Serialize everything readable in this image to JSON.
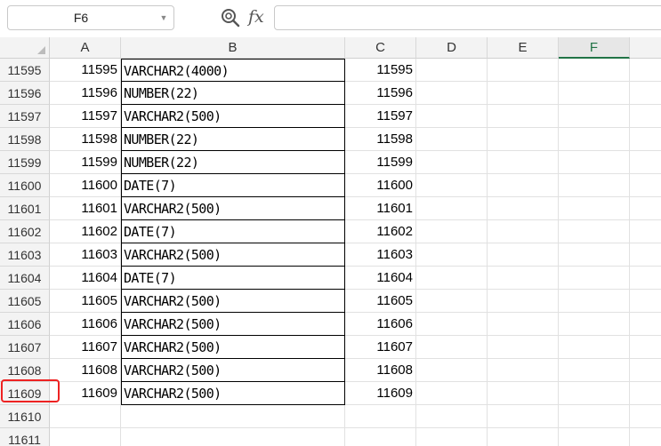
{
  "formula_bar": {
    "name_box": "F6",
    "fx_label": "fx",
    "formula_value": ""
  },
  "columns": [
    {
      "label": "A"
    },
    {
      "label": "B"
    },
    {
      "label": "C"
    },
    {
      "label": "D"
    },
    {
      "label": "E"
    },
    {
      "label": "F"
    }
  ],
  "active_column": "F",
  "rows": [
    {
      "row": "11595",
      "a": "11595",
      "b": "VARCHAR2(4000)",
      "c": "11595"
    },
    {
      "row": "11596",
      "a": "11596",
      "b": "NUMBER(22)",
      "c": "11596"
    },
    {
      "row": "11597",
      "a": "11597",
      "b": "VARCHAR2(500)",
      "c": "11597"
    },
    {
      "row": "11598",
      "a": "11598",
      "b": "NUMBER(22)",
      "c": "11598"
    },
    {
      "row": "11599",
      "a": "11599",
      "b": "NUMBER(22)",
      "c": "11599"
    },
    {
      "row": "11600",
      "a": "11600",
      "b": "DATE(7)",
      "c": "11600"
    },
    {
      "row": "11601",
      "a": "11601",
      "b": "VARCHAR2(500)",
      "c": "11601"
    },
    {
      "row": "11602",
      "a": "11602",
      "b": "DATE(7)",
      "c": "11602"
    },
    {
      "row": "11603",
      "a": "11603",
      "b": "VARCHAR2(500)",
      "c": "11603"
    },
    {
      "row": "11604",
      "a": "11604",
      "b": "DATE(7)",
      "c": "11604"
    },
    {
      "row": "11605",
      "a": "11605",
      "b": "VARCHAR2(500)",
      "c": "11605"
    },
    {
      "row": "11606",
      "a": "11606",
      "b": "VARCHAR2(500)",
      "c": "11606"
    },
    {
      "row": "11607",
      "a": "11607",
      "b": "VARCHAR2(500)",
      "c": "11607"
    },
    {
      "row": "11608",
      "a": "11608",
      "b": "VARCHAR2(500)",
      "c": "11608"
    },
    {
      "row": "11609",
      "a": "11609",
      "b": "VARCHAR2(500)",
      "c": "11609"
    },
    {
      "row": "11610",
      "a": "",
      "b": "",
      "c": ""
    },
    {
      "row": "11611",
      "a": "",
      "b": "",
      "c": ""
    }
  ],
  "highlight_color": "#ee2222",
  "accent_color": "#217346"
}
